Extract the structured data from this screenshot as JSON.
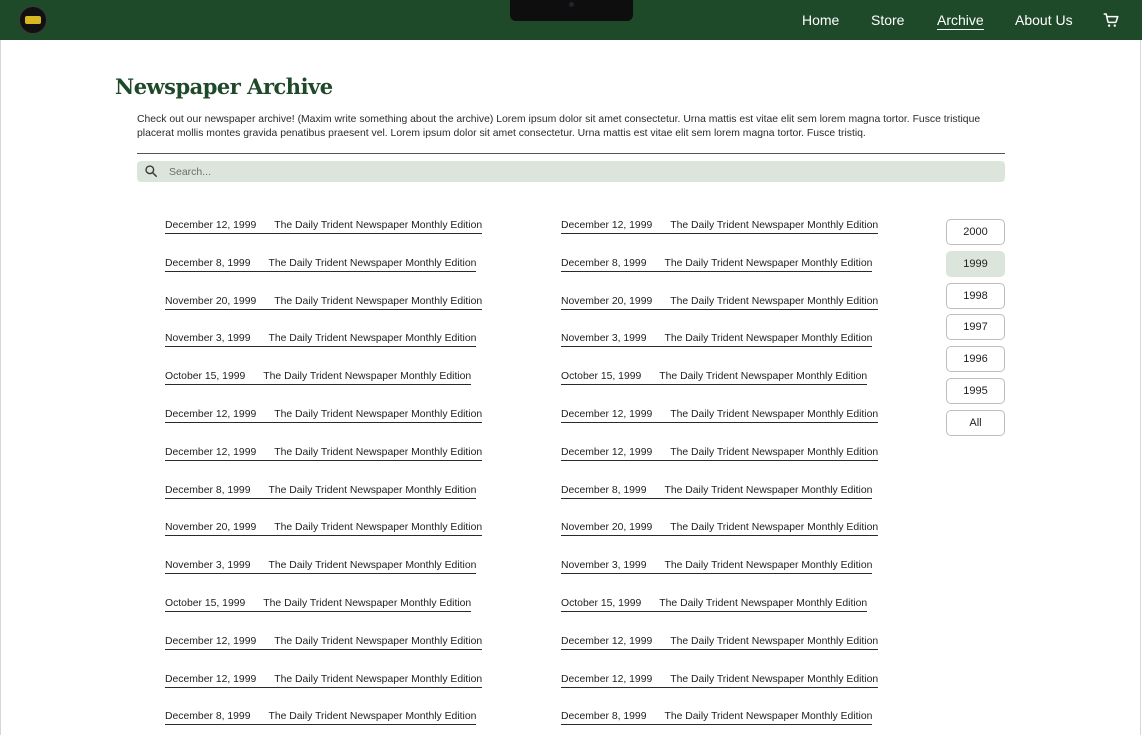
{
  "nav": {
    "links": [
      {
        "label": "Home",
        "active": false
      },
      {
        "label": "Store",
        "active": false
      },
      {
        "label": "Archive",
        "active": true
      },
      {
        "label": "About Us",
        "active": false
      }
    ],
    "logo_icon": "trident-logo-icon",
    "cart_icon": "shopping-cart-icon"
  },
  "page": {
    "title": "Newspaper Archive",
    "intro": "Check out our newspaper archive! (Maxim write something about the archive) Lorem ipsum dolor sit amet consectetur. Urna mattis est vitae elit sem lorem magna tortor. Fusce tristique placerat mollis montes gravida penatibus praesent vel. Lorem ipsum dolor sit amet consectetur. Urna mattis est vitae elit sem lorem magna tortor. Fusce tristiq."
  },
  "search": {
    "placeholder": "Search...",
    "value": "",
    "icon": "search-icon"
  },
  "archive": {
    "columns": [
      [
        {
          "date": "December 12, 1999",
          "title": "The Daily Trident Newspaper Monthly Edition"
        },
        {
          "date": "December 8, 1999",
          "title": "The Daily Trident Newspaper Monthly Edition"
        },
        {
          "date": "November 20, 1999",
          "title": "The Daily Trident Newspaper Monthly Edition"
        },
        {
          "date": "November 3, 1999",
          "title": "The Daily Trident Newspaper Monthly Edition"
        },
        {
          "date": "October 15, 1999",
          "title": "The Daily Trident Newspaper Monthly Edition"
        },
        {
          "date": "December 12, 1999",
          "title": "The Daily Trident Newspaper Monthly Edition"
        },
        {
          "date": "December 12, 1999",
          "title": "The Daily Trident Newspaper Monthly Edition"
        },
        {
          "date": "December 8, 1999",
          "title": "The Daily Trident Newspaper Monthly Edition"
        },
        {
          "date": "November 20, 1999",
          "title": "The Daily Trident Newspaper Monthly Edition"
        },
        {
          "date": "November 3, 1999",
          "title": "The Daily Trident Newspaper Monthly Edition"
        },
        {
          "date": "October 15, 1999",
          "title": "The Daily Trident Newspaper Monthly Edition"
        },
        {
          "date": "December 12, 1999",
          "title": "The Daily Trident Newspaper Monthly Edition"
        },
        {
          "date": "December 12, 1999",
          "title": "The Daily Trident Newspaper Monthly Edition"
        },
        {
          "date": "December 8, 1999",
          "title": "The Daily Trident Newspaper Monthly Edition"
        }
      ],
      [
        {
          "date": "December 12, 1999",
          "title": "The Daily Trident Newspaper Monthly Edition"
        },
        {
          "date": "December 8, 1999",
          "title": "The Daily Trident Newspaper Monthly Edition"
        },
        {
          "date": "November 20, 1999",
          "title": "The Daily Trident Newspaper Monthly Edition"
        },
        {
          "date": "November 3, 1999",
          "title": "The Daily Trident Newspaper Monthly Edition"
        },
        {
          "date": "October 15, 1999",
          "title": "The Daily Trident Newspaper Monthly Edition"
        },
        {
          "date": "December 12, 1999",
          "title": "The Daily Trident Newspaper Monthly Edition"
        },
        {
          "date": "December 12, 1999",
          "title": "The Daily Trident Newspaper Monthly Edition"
        },
        {
          "date": "December 8, 1999",
          "title": "The Daily Trident Newspaper Monthly Edition"
        },
        {
          "date": "November 20, 1999",
          "title": "The Daily Trident Newspaper Monthly Edition"
        },
        {
          "date": "November 3, 1999",
          "title": "The Daily Trident Newspaper Monthly Edition"
        },
        {
          "date": "October 15, 1999",
          "title": "The Daily Trident Newspaper Monthly Edition"
        },
        {
          "date": "December 12, 1999",
          "title": "The Daily Trident Newspaper Monthly Edition"
        },
        {
          "date": "December 12, 1999",
          "title": "The Daily Trident Newspaper Monthly Edition"
        },
        {
          "date": "December 8, 1999",
          "title": "The Daily Trident Newspaper Monthly Edition"
        }
      ]
    ]
  },
  "year_filter": {
    "years": [
      "2000",
      "1999",
      "1998",
      "1997",
      "1996",
      "1995",
      "All"
    ],
    "selected": "1999"
  },
  "colors": {
    "brand_green": "#1f4a2a",
    "selected_bg": "#dce5dc",
    "search_bg": "#dce5dc"
  }
}
